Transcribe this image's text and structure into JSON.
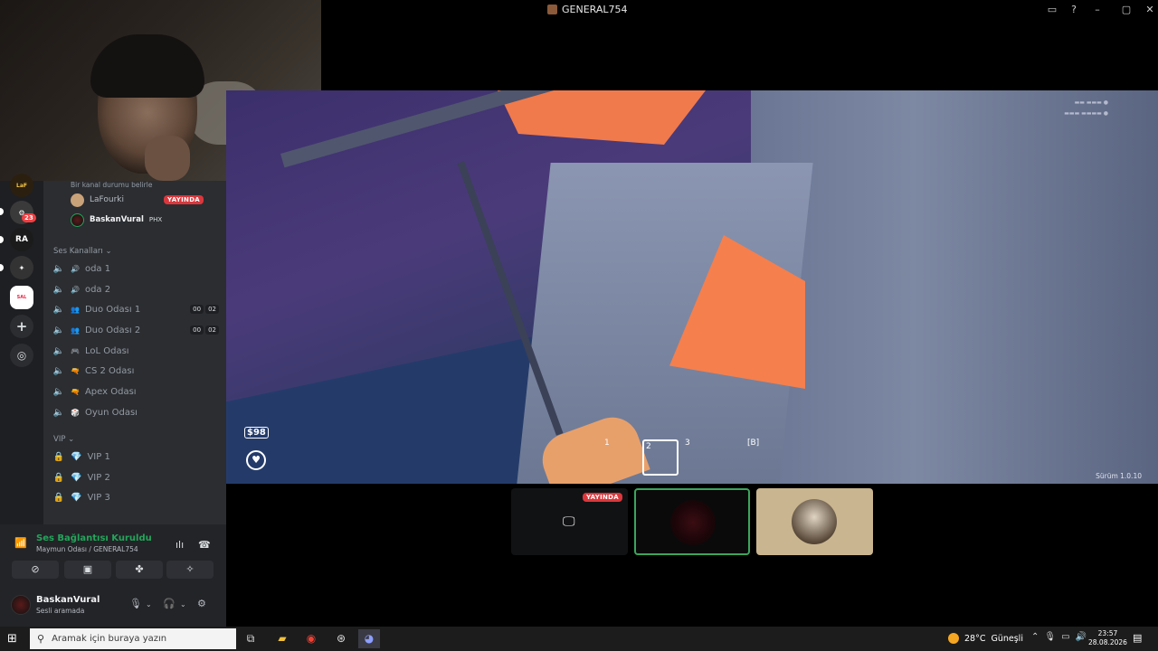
{
  "window": {
    "title": "GENERAL754"
  },
  "sidebar": {
    "servers": [
      {
        "name": "LaFourki",
        "badge": ""
      },
      {
        "name": "server-2",
        "badge": "23"
      },
      {
        "name": "RA",
        "badge": ""
      },
      {
        "name": "server-4",
        "badge": ""
      },
      {
        "name": "server-5",
        "badge": ""
      }
    ],
    "status_hint": "Bir kanal durumu belirle",
    "voice_users": [
      {
        "name": "LaFourki",
        "tag": "YAYINDA"
      },
      {
        "name": "BaskanVural",
        "tag": "PHX"
      }
    ],
    "voice_category": "Ses Kanalları",
    "voice_channels": [
      {
        "label": "oda 1",
        "icon": "🔊"
      },
      {
        "label": "oda 2",
        "icon": "🔊"
      },
      {
        "label": "Duo Odası 1",
        "icon": "👥",
        "count_a": "00",
        "count_b": "02"
      },
      {
        "label": "Duo Odası 2",
        "icon": "👥",
        "count_a": "00",
        "count_b": "02"
      },
      {
        "label": "LoL Odası",
        "icon": "🎮"
      },
      {
        "label": "CS 2 Odası",
        "icon": "🔫"
      },
      {
        "label": "Apex Odası",
        "icon": "🔫"
      },
      {
        "label": "Oyun Odası",
        "icon": "🎲"
      }
    ],
    "vip_category": "VIP",
    "vip_channels": [
      {
        "label": "VIP 1"
      },
      {
        "label": "VIP 2"
      },
      {
        "label": "VIP 3"
      }
    ]
  },
  "voice_panel": {
    "status": "Ses Bağlantısı Kuruldu",
    "location": "Maymun Odası / GENERAL754",
    "user_name": "BaskanVural",
    "user_status": "Sesli aramada"
  },
  "game": {
    "money": "$98",
    "slots": [
      "1",
      "2",
      "3",
      "[B]"
    ],
    "version": "Sürüm 1.0.10"
  },
  "tiles": {
    "live_label": "YAYINDA"
  },
  "taskbar": {
    "search_placeholder": "Aramak için buraya yazın",
    "weather_temp": "28°C",
    "weather_desc": "Güneşli",
    "time": "23:57",
    "date": "28.08.2026"
  }
}
